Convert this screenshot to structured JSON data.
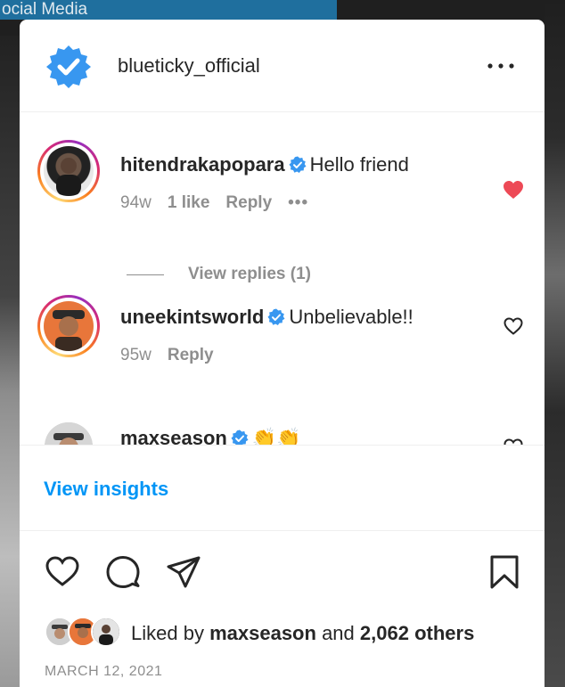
{
  "background": {
    "partial_text": "ocial Media"
  },
  "post": {
    "author": "blueticky_official",
    "more_label": "•••"
  },
  "comments": [
    {
      "username": "hitendrakapopara",
      "text": "Hello friend",
      "age": "94w",
      "likes": "1 like",
      "reply_label": "Reply",
      "more_label": "•••",
      "liked": true
    },
    {
      "username": "uneekintsworld",
      "text": "Unbelievable!!",
      "age": "95w",
      "reply_label": "Reply",
      "liked": false
    },
    {
      "username": "maxseason",
      "text": "👏👏",
      "liked": false
    }
  ],
  "view_replies_label": "View replies (1)",
  "insights_label": "View insights",
  "likes_summary": {
    "prefix": "Liked by",
    "user": "maxseason",
    "middle": "and",
    "others": "2,062 others"
  },
  "date": "MARCH 12, 2021",
  "colors": {
    "accent": "#0095f6",
    "verified": "#3897f0",
    "like_red": "#ed4956",
    "text": "#262626",
    "muted": "#8e8e8e"
  },
  "icons": [
    "verified-badge-icon",
    "more-icon",
    "heart-icon",
    "comment-icon",
    "share-icon",
    "bookmark-icon"
  ]
}
